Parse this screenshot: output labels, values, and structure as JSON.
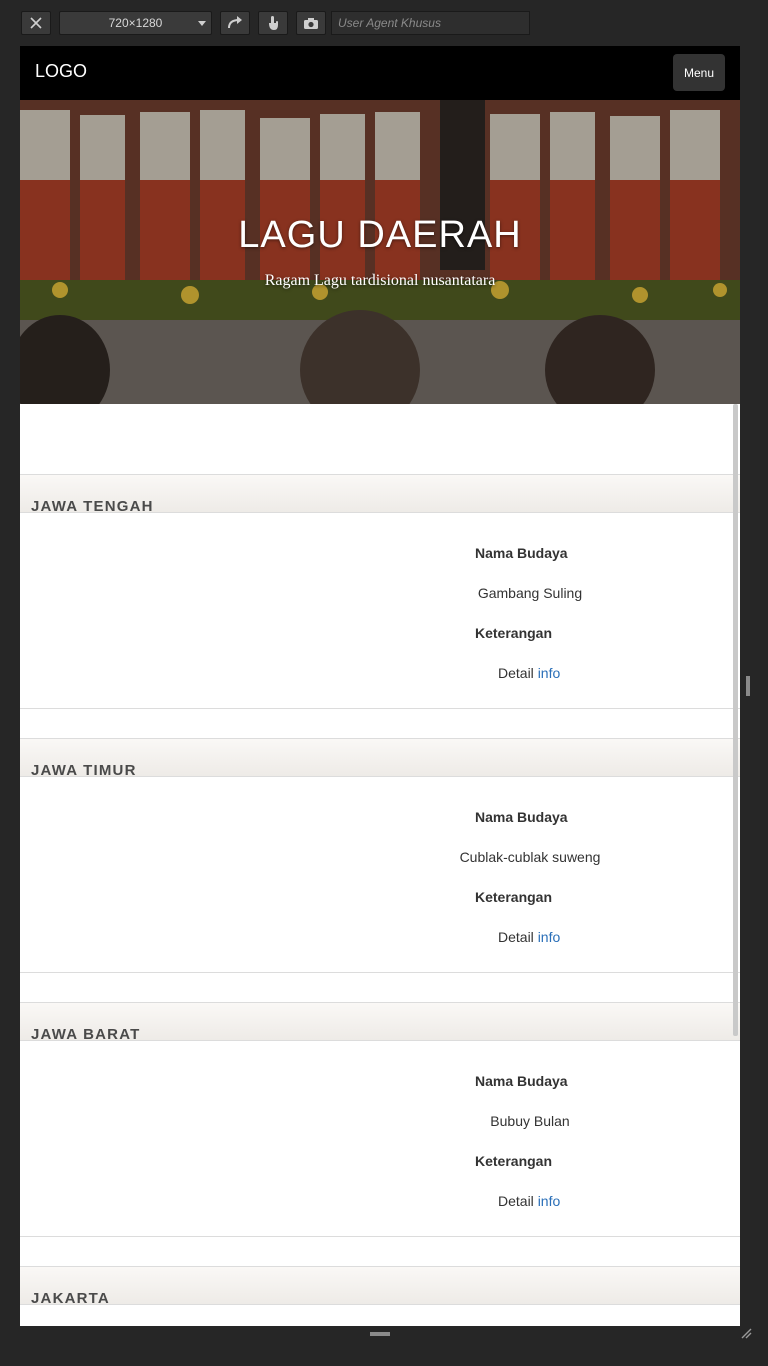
{
  "toolbar": {
    "size_label": "720×1280",
    "ua_placeholder": "User Agent Khusus",
    "icons": [
      "close-icon",
      "rotate-icon",
      "touch-icon",
      "camera-icon"
    ]
  },
  "navbar": {
    "logo": "LOGO",
    "menu_label": "Menu"
  },
  "hero": {
    "title": "LAGU DAERAH",
    "subtitle": "Ragam Lagu tardisional nusantatara"
  },
  "sections": [
    {
      "title": "JAWA TENGAH",
      "name_label": "Nama Budaya",
      "name_value": "Gambang Suling",
      "desc_label": "Keterangan",
      "detail_text": "Detail",
      "detail_link": "info"
    },
    {
      "title": "JAWA TIMUR",
      "name_label": "Nama Budaya",
      "name_value": "Cublak-cublak suweng",
      "desc_label": "Keterangan",
      "detail_text": "Detail",
      "detail_link": "info"
    },
    {
      "title": "JAWA BARAT",
      "name_label": "Nama Budaya",
      "name_value": "Bubuy Bulan",
      "desc_label": "Keterangan",
      "detail_text": "Detail",
      "detail_link": "info"
    },
    {
      "title": "JAKARTA"
    }
  ],
  "colors": {
    "link": "#2a6fb8",
    "navbar": "#000000",
    "chrome": "#262626"
  }
}
